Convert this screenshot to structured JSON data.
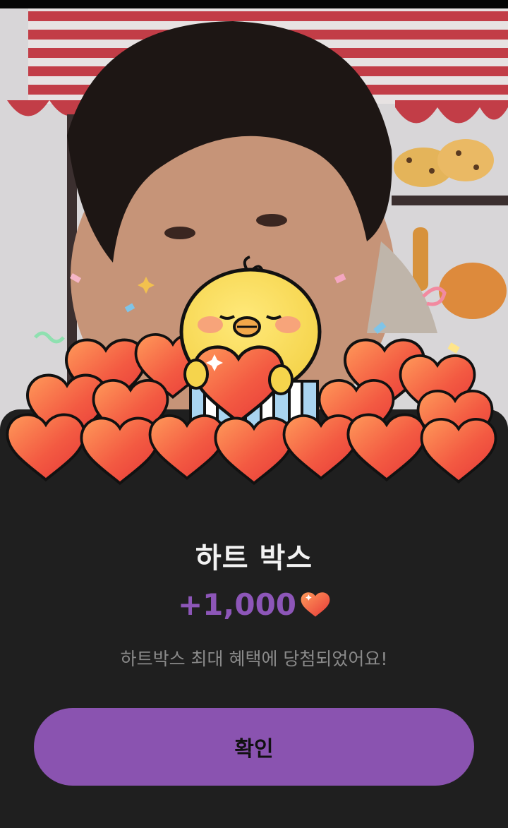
{
  "modal": {
    "title": "하트 박스",
    "amount": "+1,000",
    "message": "하트박스 최대 혜택에 당첨되었어요!",
    "confirm_label": "확인"
  },
  "icons": {
    "amount_icon": "heart-icon",
    "illustration": "chick-holding-heart"
  },
  "colors": {
    "accent": "#8a53b0",
    "amount": "#8d56b8",
    "sheet_bg": "#1f1f1f",
    "heart": "#f2544a"
  }
}
